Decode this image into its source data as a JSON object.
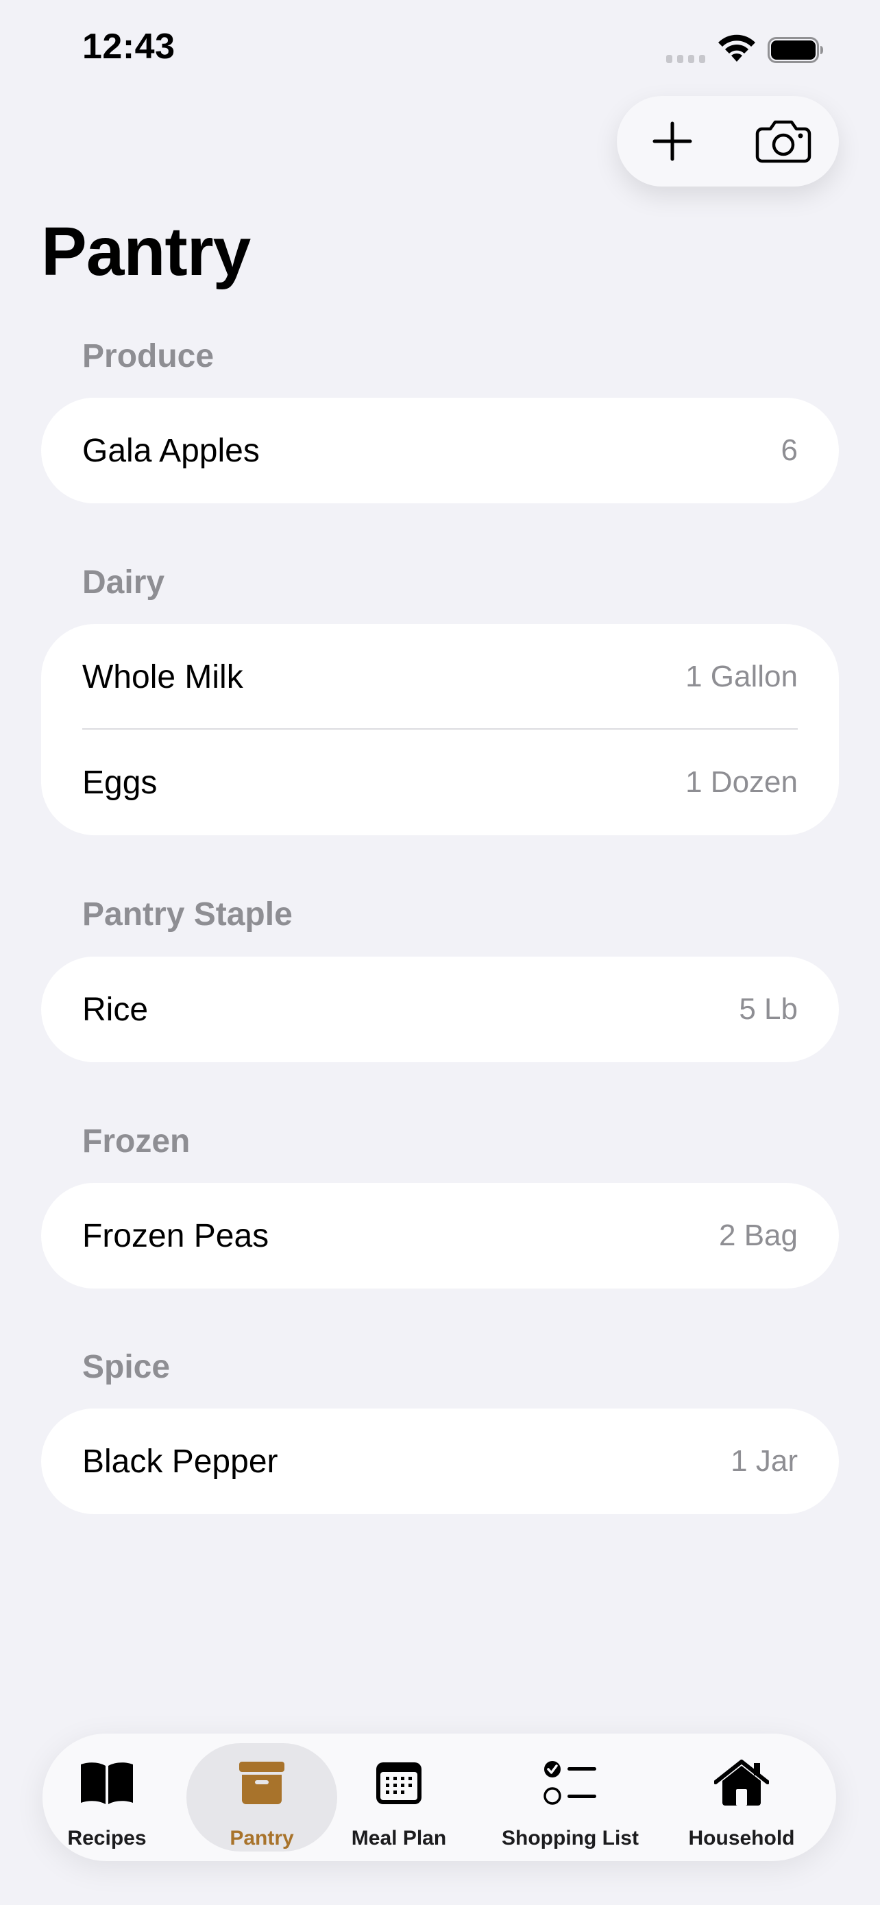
{
  "status_bar": {
    "time": "12:43"
  },
  "header": {
    "title": "Pantry"
  },
  "actions": {
    "add_icon": "plus-icon",
    "scan_icon": "camera-icon"
  },
  "sections": [
    {
      "title": "Produce",
      "items": [
        {
          "name": "Gala Apples",
          "quantity": "6"
        }
      ]
    },
    {
      "title": "Dairy",
      "items": [
        {
          "name": "Whole Milk",
          "quantity": "1 Gallon"
        },
        {
          "name": "Eggs",
          "quantity": "1 Dozen"
        }
      ]
    },
    {
      "title": "Pantry Staple",
      "items": [
        {
          "name": "Rice",
          "quantity": "5 Lb"
        }
      ]
    },
    {
      "title": "Frozen",
      "items": [
        {
          "name": "Frozen Peas",
          "quantity": "2 Bag"
        }
      ]
    },
    {
      "title": "Spice",
      "items": [
        {
          "name": "Black Pepper",
          "quantity": "1 Jar"
        }
      ]
    }
  ],
  "tab_bar": {
    "tabs": [
      {
        "label": "Recipes",
        "icon": "book-icon"
      },
      {
        "label": "Pantry",
        "icon": "archivebox-icon",
        "active": true
      },
      {
        "label": "Meal Plan",
        "icon": "calendar-icon"
      },
      {
        "label": "Shopping List",
        "icon": "checklist-icon"
      },
      {
        "label": "Household",
        "icon": "house-icon"
      }
    ]
  },
  "colors": {
    "accent": "#A8732B",
    "background": "#F2F2F7",
    "secondary_text": "#8E8E93"
  }
}
